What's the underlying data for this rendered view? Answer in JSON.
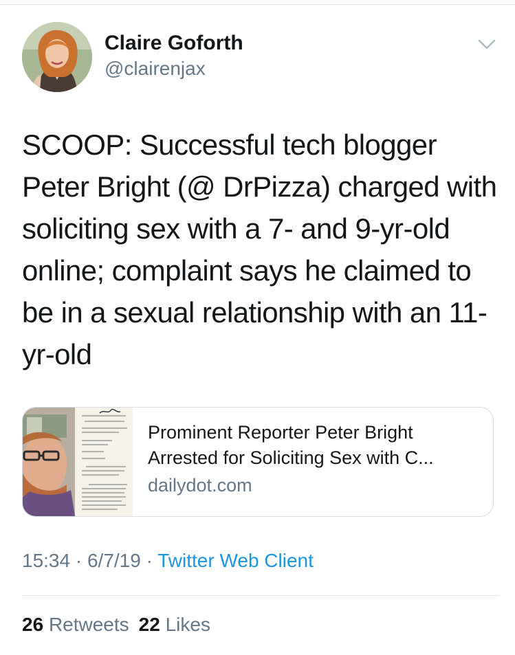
{
  "author": {
    "name": "Claire Goforth",
    "handle": "@clairenjax"
  },
  "tweet": {
    "lines": [
      "SCOOP: Successful tech blogger",
      "Peter Bright (@ DrPizza) charged with",
      "soliciting sex with a 7- and 9-yr-old",
      "online; complaint says he claimed to",
      "be in a sexual relationship with an 11-",
      "yr-old"
    ]
  },
  "card": {
    "title_lines": [
      "Prominent Reporter Peter Bright",
      "Arrested for Soliciting Sex with C..."
    ],
    "domain": "dailydot.com"
  },
  "meta": {
    "time": "15:34",
    "date": "6/7/19",
    "separator": "·",
    "client": "Twitter Web Client"
  },
  "stats": {
    "retweets_count": "26",
    "retweets_label": "Retweets",
    "likes_count": "22",
    "likes_label": "Likes"
  },
  "icons": {
    "more_menu": "chevron-down-icon"
  },
  "colors": {
    "text_primary": "#14171a",
    "text_secondary": "#657786",
    "link": "#1b95e0",
    "divider": "#e1e8ed"
  }
}
